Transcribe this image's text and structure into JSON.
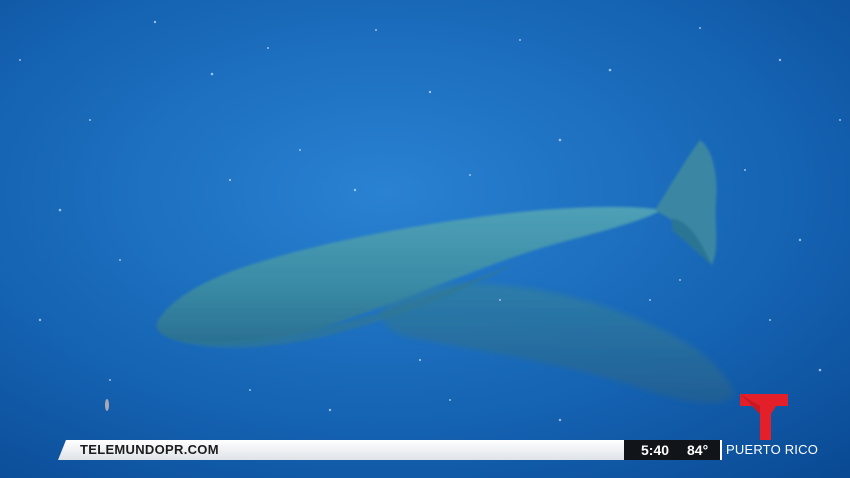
{
  "ticker": {
    "website": "TELEMUNDOPR.COM",
    "time": "5:40",
    "temperature": "84°",
    "region": "PUERTO RICO"
  },
  "colors": {
    "water_top": "#1b6fc4",
    "water_bottom": "#0a4c98",
    "whale": "#3d8da6",
    "logo_red": "#e3202a",
    "ticker_bar": "#ffffff",
    "stat_box": "#111418"
  },
  "logo": {
    "icon": "telemundo-t-logo"
  }
}
